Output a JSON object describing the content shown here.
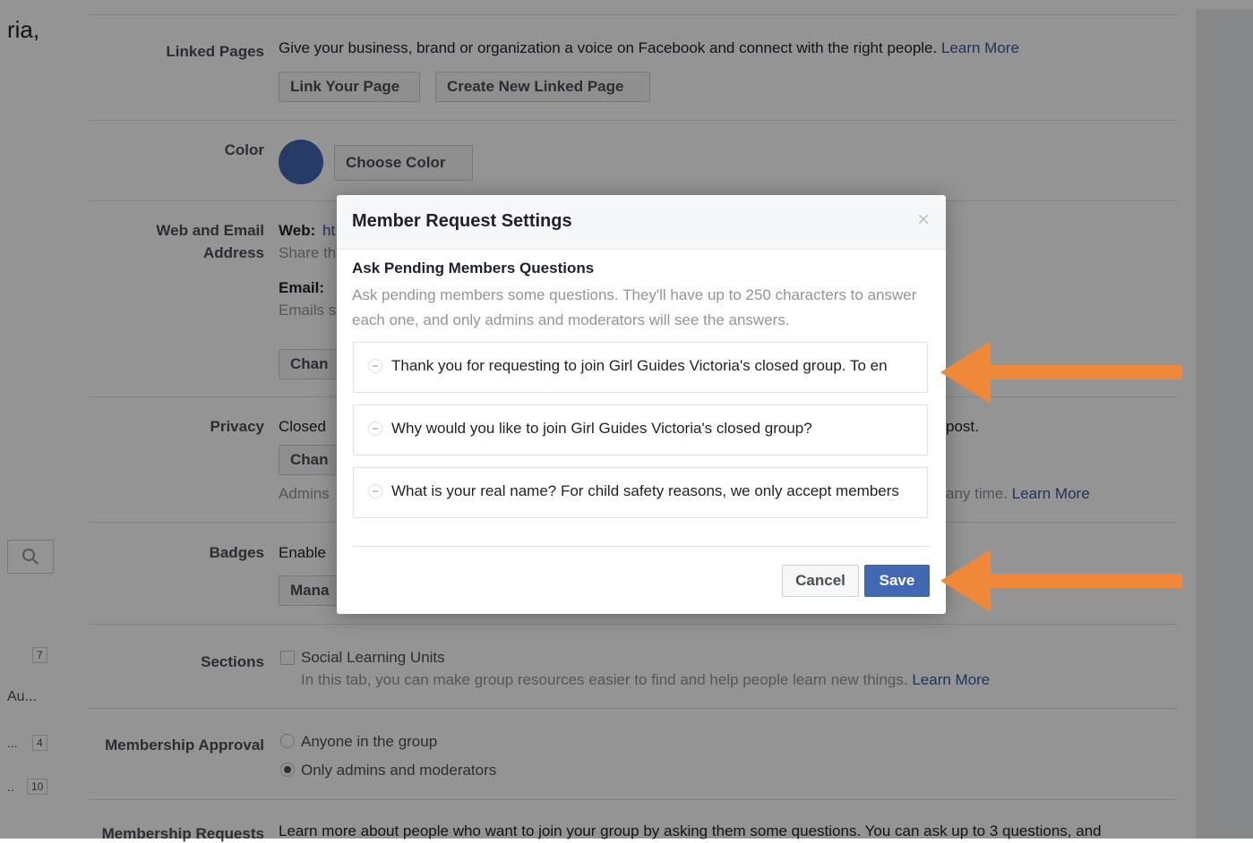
{
  "background": {
    "left_fragment_title": "ria,",
    "left_fragment_au": "Au...",
    "left_fragment_dots_a": "...",
    "left_fragment_dots_b": "..",
    "sidebar_counts": [
      "7",
      "4",
      "10"
    ],
    "rows": {
      "linked_pages": {
        "label": "Linked Pages",
        "text": "Give your business, brand or organization a voice on Facebook and connect with the right people.",
        "link": "Learn More",
        "buttons": [
          "Link Your Page",
          "Create New Linked Page"
        ]
      },
      "color": {
        "label": "Color",
        "button": "Choose Color",
        "swatch_color": "#4267b2"
      },
      "web_email": {
        "label_line1": "Web and Email",
        "label_line2": "Address",
        "web_label": "Web:",
        "web_value_fragment": "ht",
        "share_fragment": "Share th",
        "email_label": "Email:",
        "emails_fragment": "Emails s",
        "change_fragment": "Chan"
      },
      "privacy": {
        "label": "Privacy",
        "closed_fragment": "Closed",
        "change_fragment": "Chan",
        "admins_fragment": "Admins",
        "post_fragment": "post.",
        "any_time_fragment": "any time.",
        "link": "Learn More"
      },
      "badges": {
        "label": "Badges",
        "enable_fragment": "Enable",
        "manage_fragment": "Mana"
      },
      "sections": {
        "label": "Sections",
        "checkbox_label": "Social Learning Units",
        "desc": "In this tab, you can make group resources easier to find and help people learn new things.",
        "link": "Learn More"
      },
      "membership_approval": {
        "label": "Membership Approval",
        "option_1": "Anyone in the group",
        "option_2": "Only admins and moderators",
        "selected": "Only admins and moderators"
      },
      "membership_requests": {
        "label": "Membership Requests",
        "text": "Learn more about people who want to join your group by asking them some questions. You can ask up to 3 questions, and"
      }
    }
  },
  "modal": {
    "title": "Member Request Settings",
    "close_glyph": "×",
    "section_title": "Ask Pending Members Questions",
    "section_desc": "Ask pending members some questions. They'll have up to 250 characters to answer each one, and only admins and moderators will see the answers.",
    "questions": [
      "Thank you for requesting to join Girl Guides Victoria's closed group. To en",
      "Why would you like to join Girl Guides Victoria's closed group?",
      "What is your real name? For child safety reasons, we only accept members"
    ],
    "cancel_label": "Cancel",
    "save_label": "Save"
  },
  "annotations": {
    "arrow_color": "#f0883a"
  }
}
